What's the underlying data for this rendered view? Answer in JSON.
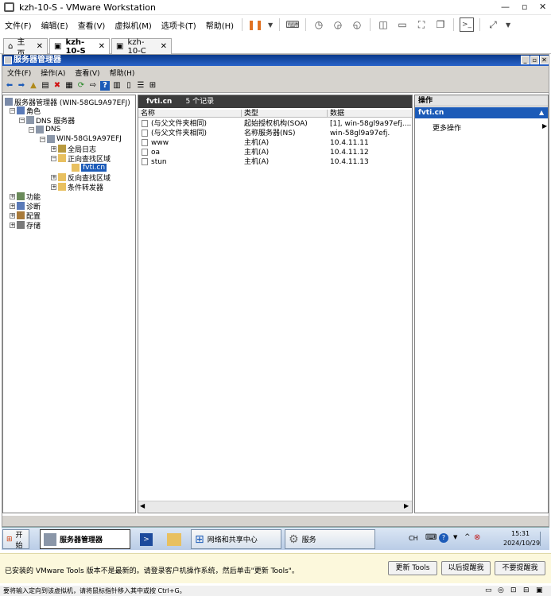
{
  "window": {
    "title": "kzh-10-S - VMware Workstation"
  },
  "vm_menu": [
    "文件(F)",
    "编辑(E)",
    "查看(V)",
    "虚拟机(M)",
    "选项卡(T)",
    "帮助(H)"
  ],
  "tabs": [
    {
      "label": "主页"
    },
    {
      "label": "kzh-10-S"
    },
    {
      "label": "kzh-10-C"
    }
  ],
  "mmc": {
    "title": "服务器管理器",
    "menu": [
      "文件(F)",
      "操作(A)",
      "查看(V)",
      "帮助(H)"
    ],
    "tree": {
      "root": "服务器管理器 (WIN-58GL9A97EFJ)",
      "roles": "角色",
      "dns_server": "DNS 服务器",
      "dns": "DNS",
      "host": "WIN-58GL9A97EFJ",
      "global_logs": "全局日志",
      "forward_zones": "正向查找区域",
      "selected_zone": "fvti.cn",
      "reverse_zones": "反向查找区域",
      "conditional_forwarders": "条件转发器",
      "features": "功能",
      "diagnostics": "诊断",
      "configuration": "配置",
      "storage": "存储"
    },
    "center": {
      "zone": "fvti.cn",
      "count": "5 个记录",
      "columns": [
        "名称",
        "类型",
        "数据"
      ],
      "rows": [
        [
          "(与父文件夹相同)",
          "起始授权机构(SOA)",
          "[1], win-58gl9a97efj...."
        ],
        [
          "(与父文件夹相同)",
          "名称服务器(NS)",
          "win-58gl9a97efj."
        ],
        [
          "www",
          "主机(A)",
          "10.4.11.11"
        ],
        [
          "oa",
          "主机(A)",
          "10.4.11.12"
        ],
        [
          "stun",
          "主机(A)",
          "10.4.11.13"
        ]
      ]
    },
    "actions": {
      "header": "操作",
      "zone": "fvti.cn",
      "more": "更多操作"
    }
  },
  "taskbar": {
    "start": "开始",
    "items": [
      "服务器管理器",
      "网络和共享中心",
      "服务"
    ],
    "lang": "CH",
    "time": "15:31",
    "date": "2024/10/29"
  },
  "notification": {
    "message": "已安装的 VMware Tools 版本不是最新的。请登录客户机操作系统，然后单击\"更新 Tools\"。",
    "buttons": [
      "更新 Tools",
      "以后提醒我",
      "不要提醒我"
    ]
  },
  "bottom_hint": "要将输入定向到该虚拟机，请将鼠标指针移入其中或按 Ctrl+G。",
  "colors": {
    "mmc_title": "#0a3a8c",
    "accent": "#1c5bb8"
  }
}
